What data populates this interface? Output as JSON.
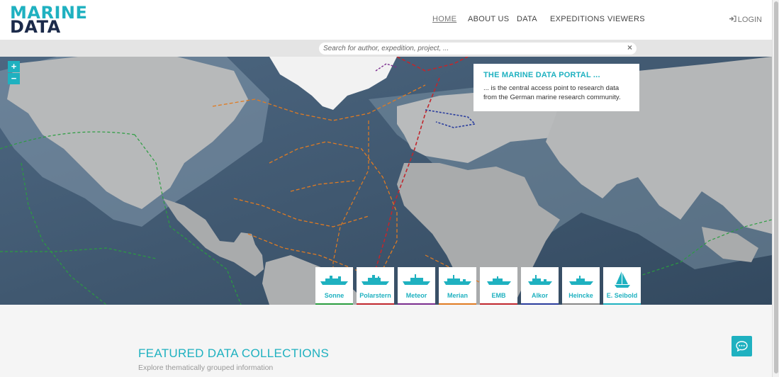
{
  "logo": {
    "line1": "MARINE",
    "line2": "DATA"
  },
  "nav": [
    {
      "label": "HOME",
      "active": true
    },
    {
      "label": "ABOUT US",
      "active": false
    },
    {
      "label": "DATA",
      "active": false
    },
    {
      "label": "EXPEDITIONS",
      "active": false
    },
    {
      "label": "VIEWERS",
      "active": false
    }
  ],
  "login": {
    "label": "LOGIN",
    "icon": "login-icon"
  },
  "search": {
    "placeholder": "Search for author, expedition, project, ...",
    "clear_icon": "×"
  },
  "map": {
    "zoom_in": "+",
    "zoom_out": "−"
  },
  "infobox": {
    "title": "THE MARINE DATA PORTAL ...",
    "text": "... is the central access point to research data from the German marine research community."
  },
  "ships": [
    {
      "name": "Sonne",
      "color": "#2a9d3f",
      "icon": "ship-icon"
    },
    {
      "name": "Polarstern",
      "color": "#c0272d",
      "icon": "ship-icon"
    },
    {
      "name": "Meteor",
      "color": "#7b2d8e",
      "icon": "ship-icon"
    },
    {
      "name": "Merian",
      "color": "#e07b22",
      "icon": "ship-icon"
    },
    {
      "name": "EMB",
      "color": "#c0272d",
      "icon": "ship-icon"
    },
    {
      "name": "Alkor",
      "color": "#2a3d9d",
      "icon": "ship-icon"
    },
    {
      "name": "Heincke",
      "color": "#888888",
      "icon": "ship-icon"
    },
    {
      "name": "E. Seibold",
      "color": "#1fb1c0",
      "icon": "sailboat-icon"
    }
  ],
  "featured": {
    "title": "FEATURED DATA COLLECTIONS",
    "subtitle": "Explore thematically grouped information"
  },
  "colors": {
    "accent": "#1fb1c0",
    "navy": "#1b2a4a"
  }
}
